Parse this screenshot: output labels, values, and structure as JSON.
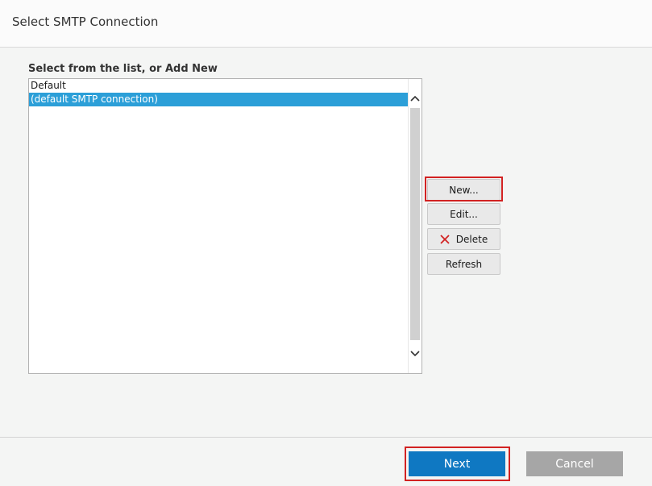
{
  "window": {
    "title": "Select SMTP Connection"
  },
  "list": {
    "label": "Select from the list, or Add New",
    "items": [
      {
        "text": "Default",
        "selected": false
      },
      {
        "text": "(default SMTP connection)",
        "selected": true
      }
    ]
  },
  "side_buttons": {
    "new_label": "New...",
    "edit_label": "Edit...",
    "delete_label": "Delete",
    "refresh_label": "Refresh",
    "delete_icon": "close-x-icon"
  },
  "footer": {
    "next_label": "Next",
    "cancel_label": "Cancel"
  },
  "colors": {
    "selection": "#2c9fd8",
    "primary_button": "#0f78c2",
    "cancel_button": "#a6a6a6",
    "highlight": "#d22222",
    "delete_icon": "#d22222"
  }
}
